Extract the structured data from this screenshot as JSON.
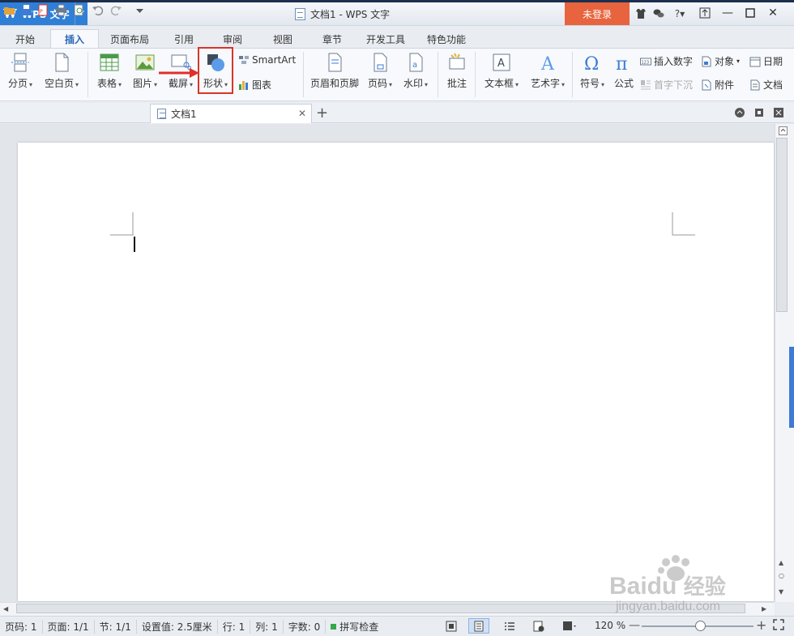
{
  "app": {
    "name": "WPS 文字",
    "logo": "W"
  },
  "window": {
    "title": "文档1 - WPS 文字",
    "login_label": "未登录"
  },
  "menu_tabs": [
    {
      "label": "开始"
    },
    {
      "label": "插入"
    },
    {
      "label": "页面布局"
    },
    {
      "label": "引用"
    },
    {
      "label": "审阅"
    },
    {
      "label": "视图"
    },
    {
      "label": "章节"
    },
    {
      "label": "开发工具"
    },
    {
      "label": "特色功能"
    }
  ],
  "active_tab": "插入",
  "ribbon": {
    "page_break": "分页",
    "blank_page": "空白页",
    "table": "表格",
    "picture": "图片",
    "screenshot": "截屏",
    "shape": "形状",
    "smartart": "SmartArt",
    "chart": "图表",
    "header_footer": "页眉和页脚",
    "page_number": "页码",
    "watermark": "水印",
    "comment": "批注",
    "textbox": "文本框",
    "wordart": "艺术字",
    "symbol": "符号",
    "formula": "公式",
    "insert_number": "插入数字",
    "drop_cap": "首字下沉",
    "object": "对象",
    "attachment": "附件",
    "date": "日期",
    "document": "文档"
  },
  "doc_tab": {
    "name": "文档1"
  },
  "status": {
    "page": "页码: 1",
    "pages": "页面: 1/1",
    "section": "节: 1/1",
    "setting": "设置值: 2.5厘米",
    "row": "行: 1",
    "col": "列: 1",
    "words": "字数: 0",
    "spell": "拼写检查",
    "zoom": "120 %"
  },
  "watermark_text": {
    "brand": "Baidu",
    "cn": "经验",
    "url": "jingyan.baidu.com"
  },
  "colors": {
    "accent": "#2f7fd7",
    "login": "#e8643e",
    "highlight": "#d9342b"
  }
}
